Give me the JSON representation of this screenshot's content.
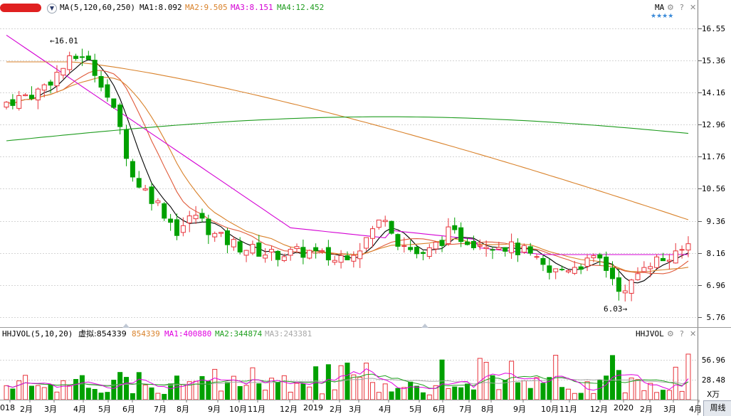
{
  "header": {
    "stock_name": "",
    "dropdown_icon": "chevron-down-icon",
    "indicator": "MA(5,120,60,250)",
    "ma1": "MA1:8.092",
    "ma2": "MA2:9.505",
    "ma3": "MA3:8.151",
    "ma4": "MA4:12.452",
    "corner_label": "MA",
    "stars": "★★★★",
    "icons": [
      "gear-icon",
      "help-icon",
      "close-icon"
    ]
  },
  "price_axis": {
    "ticks": [
      "16.55",
      "15.36",
      "14.16",
      "12.96",
      "11.76",
      "10.56",
      "9.36",
      "8.16",
      "6.96",
      "5.76"
    ]
  },
  "annotations": {
    "high": "16.01",
    "low": "6.03"
  },
  "volume_header": {
    "indicator": "HHJVOL(5,10,20)",
    "virtual": "虚拟:854339",
    "value": "854339",
    "ma1": "MA1:400880",
    "ma2": "MA2:344874",
    "ma3": "MA3:243381",
    "corner_label": "HHJVOL",
    "icons": [
      "gear-icon",
      "help-icon",
      "close-icon"
    ]
  },
  "volume_axis": {
    "ticks": [
      "56.96",
      "28.48"
    ],
    "unit": "X万"
  },
  "x_axis": {
    "labels": [
      "018",
      "2月",
      "3月",
      "4月",
      "5月",
      "6月",
      "7月",
      "8月",
      "9月",
      "10月",
      "11月",
      "12月",
      "2019",
      "2月",
      "3月",
      "4月",
      "5月",
      "6月",
      "7月",
      "8月",
      "9月",
      "10月",
      "11月",
      "12月",
      "2020",
      "2月",
      "3月",
      "4月"
    ],
    "period_button": "周线"
  },
  "colors": {
    "up": "#e8333a",
    "down": "#00a000",
    "ma1": "#000000",
    "ma2": "#d9822b",
    "ma3": "#d400d4",
    "ma4": "#1f9c1f",
    "vma1": "#e000e0",
    "vma2": "#20a020",
    "vma3": "#a8a8a8"
  },
  "chart_data": {
    "type": "candlestick",
    "price_ylim": [
      5.76,
      16.55
    ],
    "volume_ylim": [
      0,
      56.96
    ],
    "bars": 109,
    "high": 16.01,
    "low": 6.03
  }
}
